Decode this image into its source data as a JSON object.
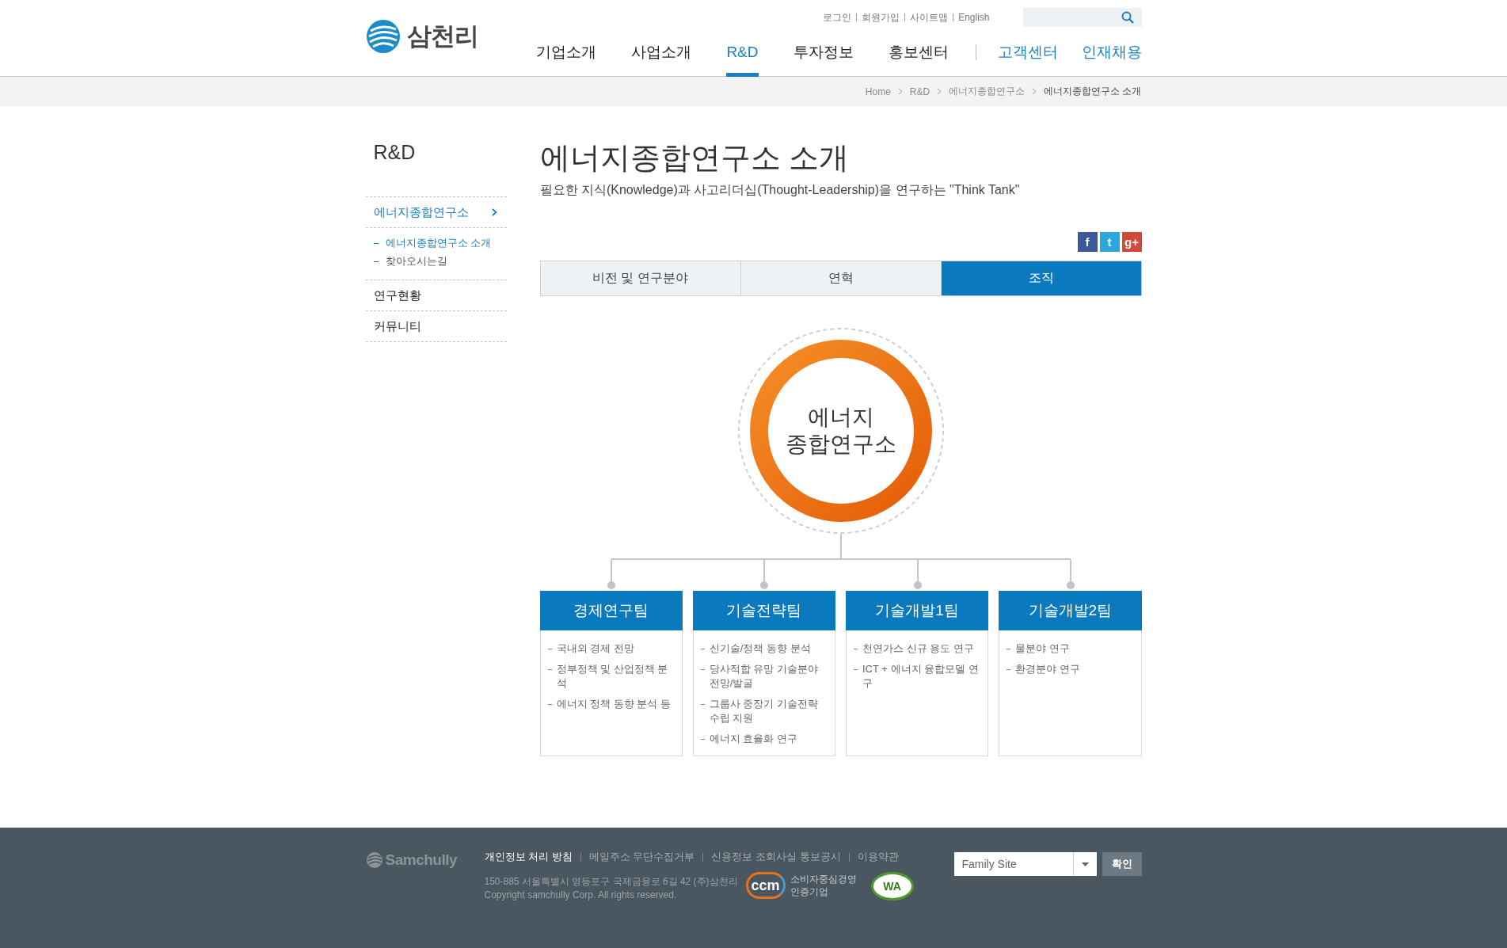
{
  "header": {
    "logo": "삼천리",
    "util_links": [
      "로그인",
      "회원가입",
      "사이트맵",
      "English"
    ],
    "nav": [
      {
        "label": "기업소개",
        "selected": false,
        "kind": "main"
      },
      {
        "label": "사업소개",
        "selected": false,
        "kind": "main"
      },
      {
        "label": "R&D",
        "selected": true,
        "kind": "main"
      },
      {
        "label": "투자정보",
        "selected": false,
        "kind": "main"
      },
      {
        "label": "홍보센터",
        "selected": false,
        "kind": "main"
      },
      {
        "label": "고객센터",
        "selected": false,
        "kind": "sub"
      },
      {
        "label": "인재채용",
        "selected": false,
        "kind": "sub"
      }
    ]
  },
  "breadcrumb": [
    "Home",
    "R&D",
    "에너지종합연구소",
    "에너지종합연구소 소개"
  ],
  "sidebar": {
    "title": "R&D",
    "items": [
      {
        "label": "에너지종합연구소",
        "selected": true,
        "expanded": true,
        "children": [
          {
            "label": "에너지종합연구소 소개",
            "selected": true
          },
          {
            "label": "찾아오시는길",
            "selected": false
          }
        ]
      },
      {
        "label": "연구현황",
        "selected": false,
        "expanded": false
      },
      {
        "label": "커뮤니티",
        "selected": false,
        "expanded": false
      }
    ]
  },
  "page": {
    "title": "에너지종합연구소 소개",
    "subtitle": "필요한 지식(Knowledge)과 사고리더십(Thought-Leadership)을 연구하는 \"Think Tank\"",
    "share": [
      {
        "glyph": "f",
        "color": "#3b5998"
      },
      {
        "glyph": "t",
        "color": "#2aa7dc"
      },
      {
        "glyph": "g+",
        "color": "#d34836"
      }
    ],
    "tabs": [
      {
        "label": "비전 및 연구분야",
        "selected": false
      },
      {
        "label": "연혁",
        "selected": false
      },
      {
        "label": "조직",
        "selected": true
      }
    ],
    "org": {
      "center": [
        "에너지",
        "종합연구소"
      ],
      "teams": [
        {
          "name": "경제연구팀",
          "tasks": [
            "국내외 경제 전망",
            "정부정책 및 산업정책 분석",
            "에너지 정책 동향 분석 등"
          ]
        },
        {
          "name": "기술전략팀",
          "tasks": [
            "신기술/정책 동향 분석",
            "당사적합 유망 기술분야 전망/발굴",
            "그룹사 중장기 기술전략 수립 지원",
            "에너지 효율화 연구"
          ]
        },
        {
          "name": "기술개발1팀",
          "tasks": [
            "천연가스 신규 용도 연구",
            "ICT + 에너지 융합모델 연구"
          ]
        },
        {
          "name": "기술개발2팀",
          "tasks": [
            "물분야 연구",
            "환경분야 연구"
          ]
        }
      ]
    }
  },
  "footer": {
    "logo": "Samchully",
    "links": [
      {
        "label": "개인정보 처리 방침",
        "selected": true
      },
      {
        "label": "메일주소 무단수집거부",
        "selected": false
      },
      {
        "label": "신용정보 조회사실 통보공시",
        "selected": false
      },
      {
        "label": "이용약관",
        "selected": false
      }
    ],
    "address": "150-885 서울특별시 영등포구 국제금융로 6길 42 (주)삼천리",
    "copyright": "Copyright samchully Corp. All rights reserved.",
    "ccm": {
      "mark": "ccm",
      "caption": [
        "소비자중심경영",
        "인증기업"
      ]
    },
    "wa": {
      "mark": "WA"
    },
    "family_site": {
      "value": "Family Site"
    },
    "confirm": "확인"
  }
}
